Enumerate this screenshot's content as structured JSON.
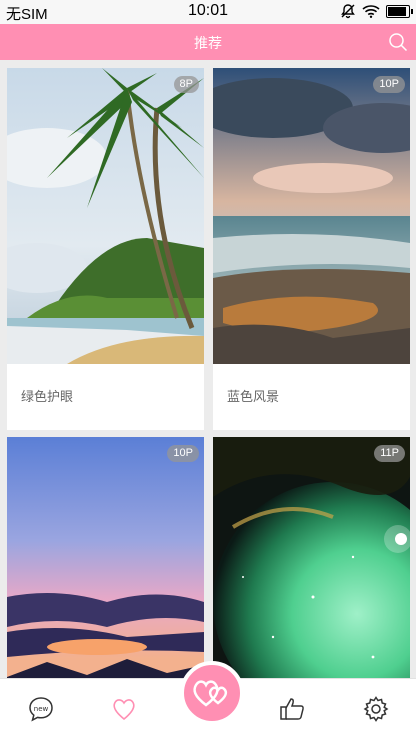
{
  "status_bar": {
    "carrier": "无SIM",
    "time": "10:01"
  },
  "header": {
    "title": "推荐"
  },
  "feed": {
    "cards": [
      {
        "count": "8P",
        "caption": "绿色护眼"
      },
      {
        "count": "10P",
        "caption": "蓝色风景"
      },
      {
        "count": "10P",
        "caption": ""
      },
      {
        "count": "11P",
        "caption": ""
      }
    ]
  },
  "icons": {
    "status": [
      "silent-icon",
      "wifi-icon",
      "battery-icon"
    ],
    "header": [
      "search-icon"
    ],
    "tabs": [
      "new-chat-icon",
      "heart-icon",
      "love-center-icon",
      "thumbs-up-icon",
      "settings-icon"
    ]
  },
  "tabbar": {
    "new_label": "new"
  },
  "colors": {
    "accent": "#ff8fb3",
    "status_bg": "#f7f7f7",
    "page_bg": "#ececec"
  }
}
